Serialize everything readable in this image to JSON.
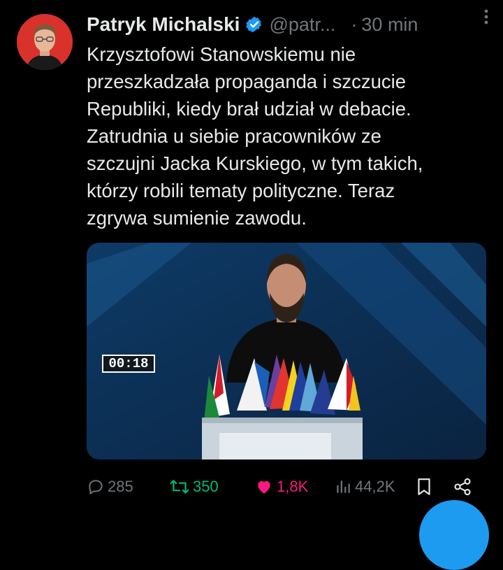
{
  "tweet": {
    "author_name": "Patryk Michalski",
    "handle": "@patr...",
    "separator": "·",
    "time": "30 min",
    "text": "Krzysztofowi Stanowskiemu nie\nprzeszkadzała propaganda i szczucie\nRepubliki, kiedy brał udział w debacie.\nZatrudnia u siebie pracowników ze\nszczujni Jacka Kurskiego, w tym takich,\nktórzy robili tematy polityczne. Teraz\nzgrywa sumienie zawodu."
  },
  "media": {
    "timer": "00:18"
  },
  "actions": {
    "replies": "285",
    "retweets": "350",
    "likes": "1,8K",
    "views": "44,2K"
  },
  "icons": {
    "verified": "verified-badge-icon",
    "more": "more-icon",
    "reply": "reply-icon",
    "retweet": "retweet-icon",
    "like": "heart-icon",
    "views": "views-icon",
    "bookmark": "bookmark-icon",
    "share": "share-icon"
  },
  "colors": {
    "background": "#000000",
    "text": "#e7e9ea",
    "secondary": "#71767b",
    "accent": "#1d9bf0",
    "retweet": "#00ba7c",
    "like": "#f91880",
    "avatar_bg": "#d8322b"
  }
}
